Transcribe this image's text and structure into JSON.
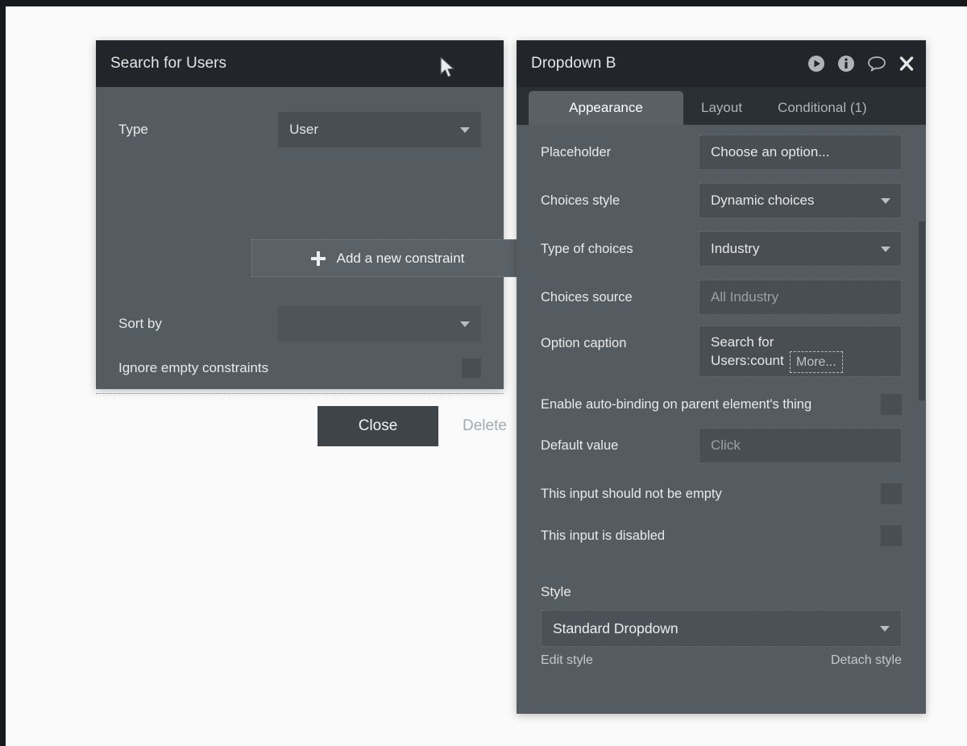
{
  "colors": {
    "page_bg": "#fafafa",
    "frame": "#17191c",
    "panel_bg": "#555c61",
    "titlebar_bg": "#22262a",
    "field_bg": "#494e52",
    "tabbar_bg": "#2b3034",
    "active_tab_bg": "#5a6166",
    "text": "#e8eaeb",
    "muted_text": "#9aa1a6"
  },
  "search_panel": {
    "title": "Search for Users",
    "type_row": {
      "label": "Type",
      "value": "User"
    },
    "add_constraint_label": "Add a new constraint",
    "add_constraint_icon": "plus-icon",
    "sort_row": {
      "label": "Sort by",
      "value": ""
    },
    "ignore_row": {
      "label": "Ignore empty constraints",
      "checked": false
    },
    "footer": {
      "close_label": "Close",
      "delete_label": "Delete"
    }
  },
  "dropdown_panel": {
    "title": "Dropdown B",
    "title_icons": [
      {
        "name": "play-icon",
        "label": "Preview"
      },
      {
        "name": "info-icon",
        "label": "Info"
      },
      {
        "name": "comment-icon",
        "label": "Comment"
      },
      {
        "name": "close-icon",
        "label": "Close"
      }
    ],
    "tabs": [
      {
        "label": "Appearance",
        "active": true
      },
      {
        "label": "Layout",
        "active": false
      },
      {
        "label": "Conditional (1)",
        "active": false
      }
    ],
    "fields": {
      "placeholder": {
        "label": "Placeholder",
        "value": "Choose an option..."
      },
      "choices_style": {
        "label": "Choices style",
        "value": "Dynamic choices"
      },
      "type_of_choices": {
        "label": "Type of choices",
        "value": "Industry"
      },
      "choices_source": {
        "label": "Choices source",
        "value": "All Industry"
      },
      "option_caption": {
        "label": "Option caption",
        "line1": "Search for",
        "line2": "Users:count",
        "more_label": "More..."
      },
      "auto_binding": {
        "label": "Enable auto-binding on parent element's thing",
        "checked": false
      },
      "default_value": {
        "label": "Default value",
        "value": "Click"
      },
      "not_empty": {
        "label": "This input should not be empty",
        "checked": false
      },
      "disabled": {
        "label": "This input is disabled",
        "checked": false
      }
    },
    "style_section": {
      "label": "Style",
      "selected": "Standard Dropdown",
      "edit_link": "Edit style",
      "detach_link": "Detach style"
    }
  }
}
